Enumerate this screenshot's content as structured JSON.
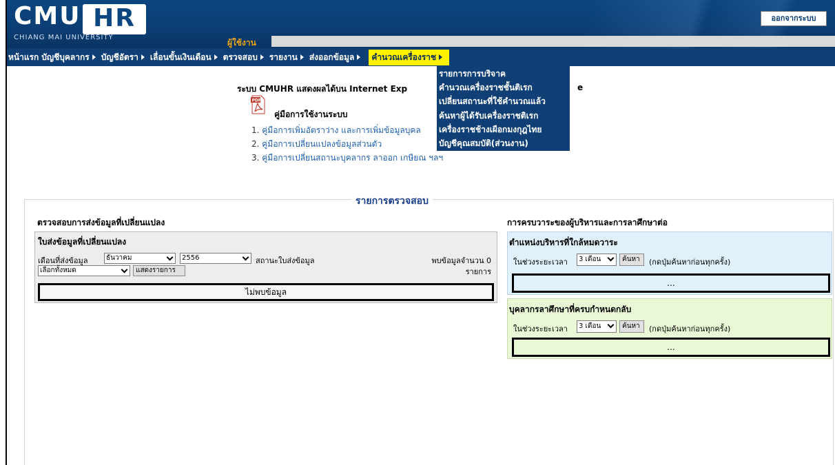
{
  "header": {
    "logo_main": "CMU",
    "logo_hr": "HR",
    "logo_sub": "CHIANG MAI UNIVERSITY",
    "user_label": "ผู้ใช้งาน",
    "logout_label": "ออกจากระบบ"
  },
  "nav": {
    "items": [
      {
        "label": "หน้าแรก",
        "has_arrow": false
      },
      {
        "label": "บัญชีบุคลากร",
        "has_arrow": true
      },
      {
        "label": "บัญชีอัตรา",
        "has_arrow": true
      },
      {
        "label": "เลื่อนขั้นเงินเดือน",
        "has_arrow": true
      },
      {
        "label": "ตรวจสอบ",
        "has_arrow": true
      },
      {
        "label": "รายงาน",
        "has_arrow": true
      },
      {
        "label": "ส่งออกข้อมูล",
        "has_arrow": true
      },
      {
        "label": "คำนวณเครื่องราช",
        "has_arrow": true,
        "active": true
      }
    ],
    "dropdown": [
      "รายการการบริจาค",
      "คำนวณเครื่องราชชั้นติเรก",
      "เปลี่ยนสถานะที่ใช้คำนวณแล้ว",
      "ค้นหาผู้ได้รับเครื่องราชติเรก",
      "เครื่องราชช้างเผือกมงกุฎไทย",
      "บัญชีคุณสมบัติ(ส่วนงาน)"
    ]
  },
  "intro": {
    "title": "ระบบ CMUHR แสดงผลได้บน Internet Exp",
    "title_tail": "e",
    "manual_title": "คู่มือการใช้งานระบบ",
    "manuals": [
      {
        "num": "1.",
        "text": "คู่มือการเพิ่มอัตราว่าง และการเพิ่มข้อมูลบุคล"
      },
      {
        "num": "2.",
        "text": "คู่มือการเปลี่ยนแปลงข้อมูลส่วนตัว"
      },
      {
        "num": "3.",
        "text": "คู่มือการเปลี่ยนสถานะบุคลากร ลาออก เกษียณ ฯลฯ"
      }
    ],
    "pdf_icon": "pdf-file-icon"
  },
  "check": {
    "title": "รายการตรวจสอบ",
    "left_heading": "ตรวจสอบการส่งข้อมูลที่เปลี่ยนแปลง",
    "change_box": {
      "title": "ใบส่งข้อมูลที่เปลี่ยนแปลง",
      "month_label": "เดือนที่ส่งข้อมูล",
      "month_value": "ธันวาคม",
      "year_value": "2556",
      "status_label": "สถานะใบส่งข้อมูล",
      "status_value": "เลือกทั้งหมด",
      "show_button": "แสดงรายการ",
      "found_text": "พบข้อมูลจำนวน 0",
      "found_unit": "รายการ",
      "no_data": "ไม่พบข้อมูล"
    },
    "right_heading": "การครบวาระของผู้บริหารและการลาศึกษาต่อ",
    "exec_box": {
      "title": "ตำแหน่งบริหารที่ใกล้หมดวาระ",
      "range_label": "ในช่วงระยะเวลา",
      "range_value": "3 เดือน",
      "search_button": "ค้นหา",
      "hint": "(กดปุ่มค้นหาก่อนทุกครั้ง)",
      "placeholder": "..."
    },
    "study_box": {
      "title": "บุคลากรลาศึกษาที่ครบกำหนดกลับ",
      "range_label": "ในช่วงระยะเวลา",
      "range_value": "3 เดือน",
      "search_button": "ค้นหา",
      "hint": "(กดปุ่มค้นหาก่อนทุกครั้ง)",
      "placeholder": "..."
    }
  },
  "colors": {
    "header_blue": "#0c4680",
    "nav_blue": "#0f3f74",
    "active_yellow": "#fff200",
    "exec_box_bg": "#e0f1fb",
    "study_box_bg": "#e9f9d6"
  }
}
